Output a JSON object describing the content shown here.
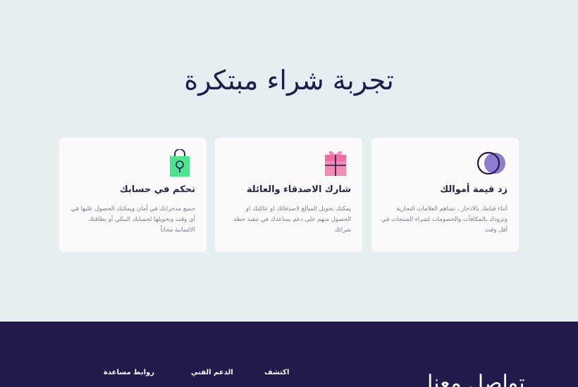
{
  "hero": {
    "title": "تجربة شراء مبتكرة"
  },
  "cards": [
    {
      "icon": "circles-icon",
      "title": "زد قيمة أموالك",
      "description": "أثناء قيامك بالادخار ، تساهم العلامات التجارية وتزودك بالمكافآت والخصومات لشراء المنتجات في أقل وقت"
    },
    {
      "icon": "gift-icon",
      "title": "شارك الاصدقاء والعائلة",
      "description": "يمكنك تحويل المبالغ لاصدقائك او عائلتك او الحصول منهم على دعم يساعدك في تنفيذ خطة شرائك"
    },
    {
      "icon": "shopping-bag-icon",
      "title": "تحكم في حسابك",
      "description": "جميع مدخراتك في أمان ويمكنك الحصول عليها في أي وقت وتحويلها لحسابك البنكي أو بطاقتك الائتمانية مجاناً"
    }
  ],
  "footer": {
    "contact_title": "تواصل معنا",
    "columns": {
      "discover": "اكتشف",
      "support": "الدعم الفني",
      "help_links": "روابط مساعدة"
    }
  },
  "colors": {
    "page_background": "#e5eef1",
    "card_background": "#fcf9fb",
    "footer_background": "#211a4a",
    "heading_text": "#1f1d4d",
    "circles_icon": "#8f7cd0",
    "gift_icon": "#f48bb4",
    "bag_icon": "#4ee38f"
  }
}
